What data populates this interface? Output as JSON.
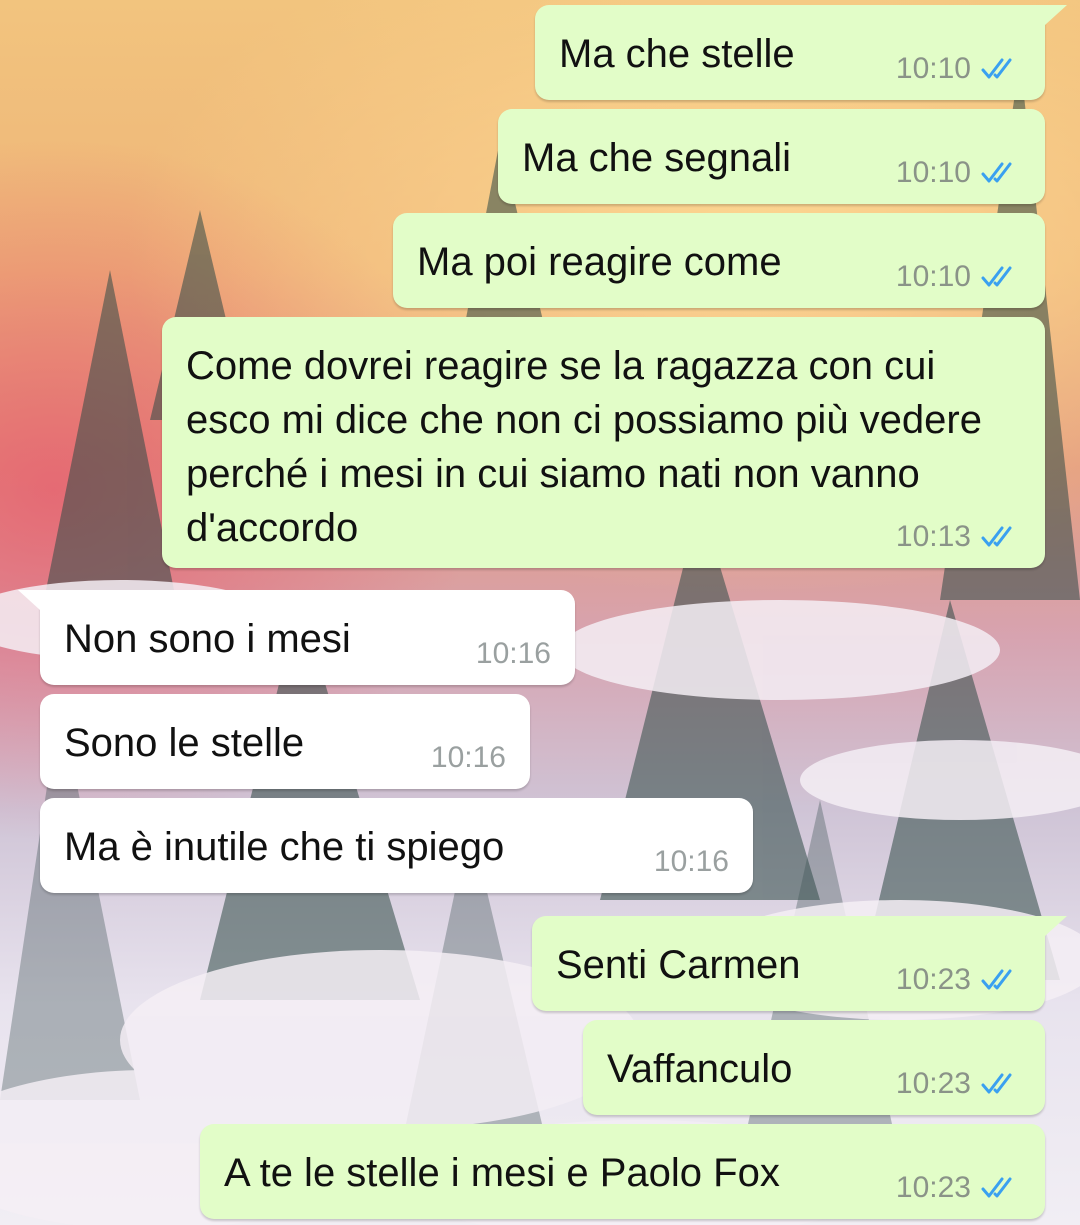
{
  "colors": {
    "outgoing_bubble": "#e2fdc8",
    "incoming_bubble": "#ffffff",
    "read_ticks": "#3aa0f0"
  },
  "messages": [
    {
      "direction": "outgoing",
      "text": "Ma che stelle",
      "time": "10:10",
      "status": "read",
      "icon": "double-check-icon"
    },
    {
      "direction": "outgoing",
      "text": "Ma che segnali",
      "time": "10:10",
      "status": "read",
      "icon": "double-check-icon"
    },
    {
      "direction": "outgoing",
      "text": "Ma poi reagire come",
      "time": "10:10",
      "status": "read",
      "icon": "double-check-icon"
    },
    {
      "direction": "outgoing",
      "text": "Come dovrei reagire se la ragazza con cui esco mi dice che non ci possiamo più vedere perché i mesi in cui siamo nati non vanno d'accordo",
      "time": "10:13",
      "status": "read",
      "icon": "double-check-icon"
    },
    {
      "direction": "incoming",
      "text": "Non sono i mesi",
      "time": "10:16"
    },
    {
      "direction": "incoming",
      "text": "Sono le stelle",
      "time": "10:16"
    },
    {
      "direction": "incoming",
      "text": "Ma è inutile che ti spiego",
      "time": "10:16"
    },
    {
      "direction": "outgoing",
      "text": "Senti Carmen",
      "time": "10:23",
      "status": "read",
      "icon": "double-check-icon"
    },
    {
      "direction": "outgoing",
      "text": "Vaffanculo",
      "time": "10:23",
      "status": "read",
      "icon": "double-check-icon"
    },
    {
      "direction": "outgoing",
      "text": "A te le stelle i mesi e Paolo Fox",
      "time": "10:23",
      "status": "read",
      "icon": "double-check-icon"
    }
  ]
}
